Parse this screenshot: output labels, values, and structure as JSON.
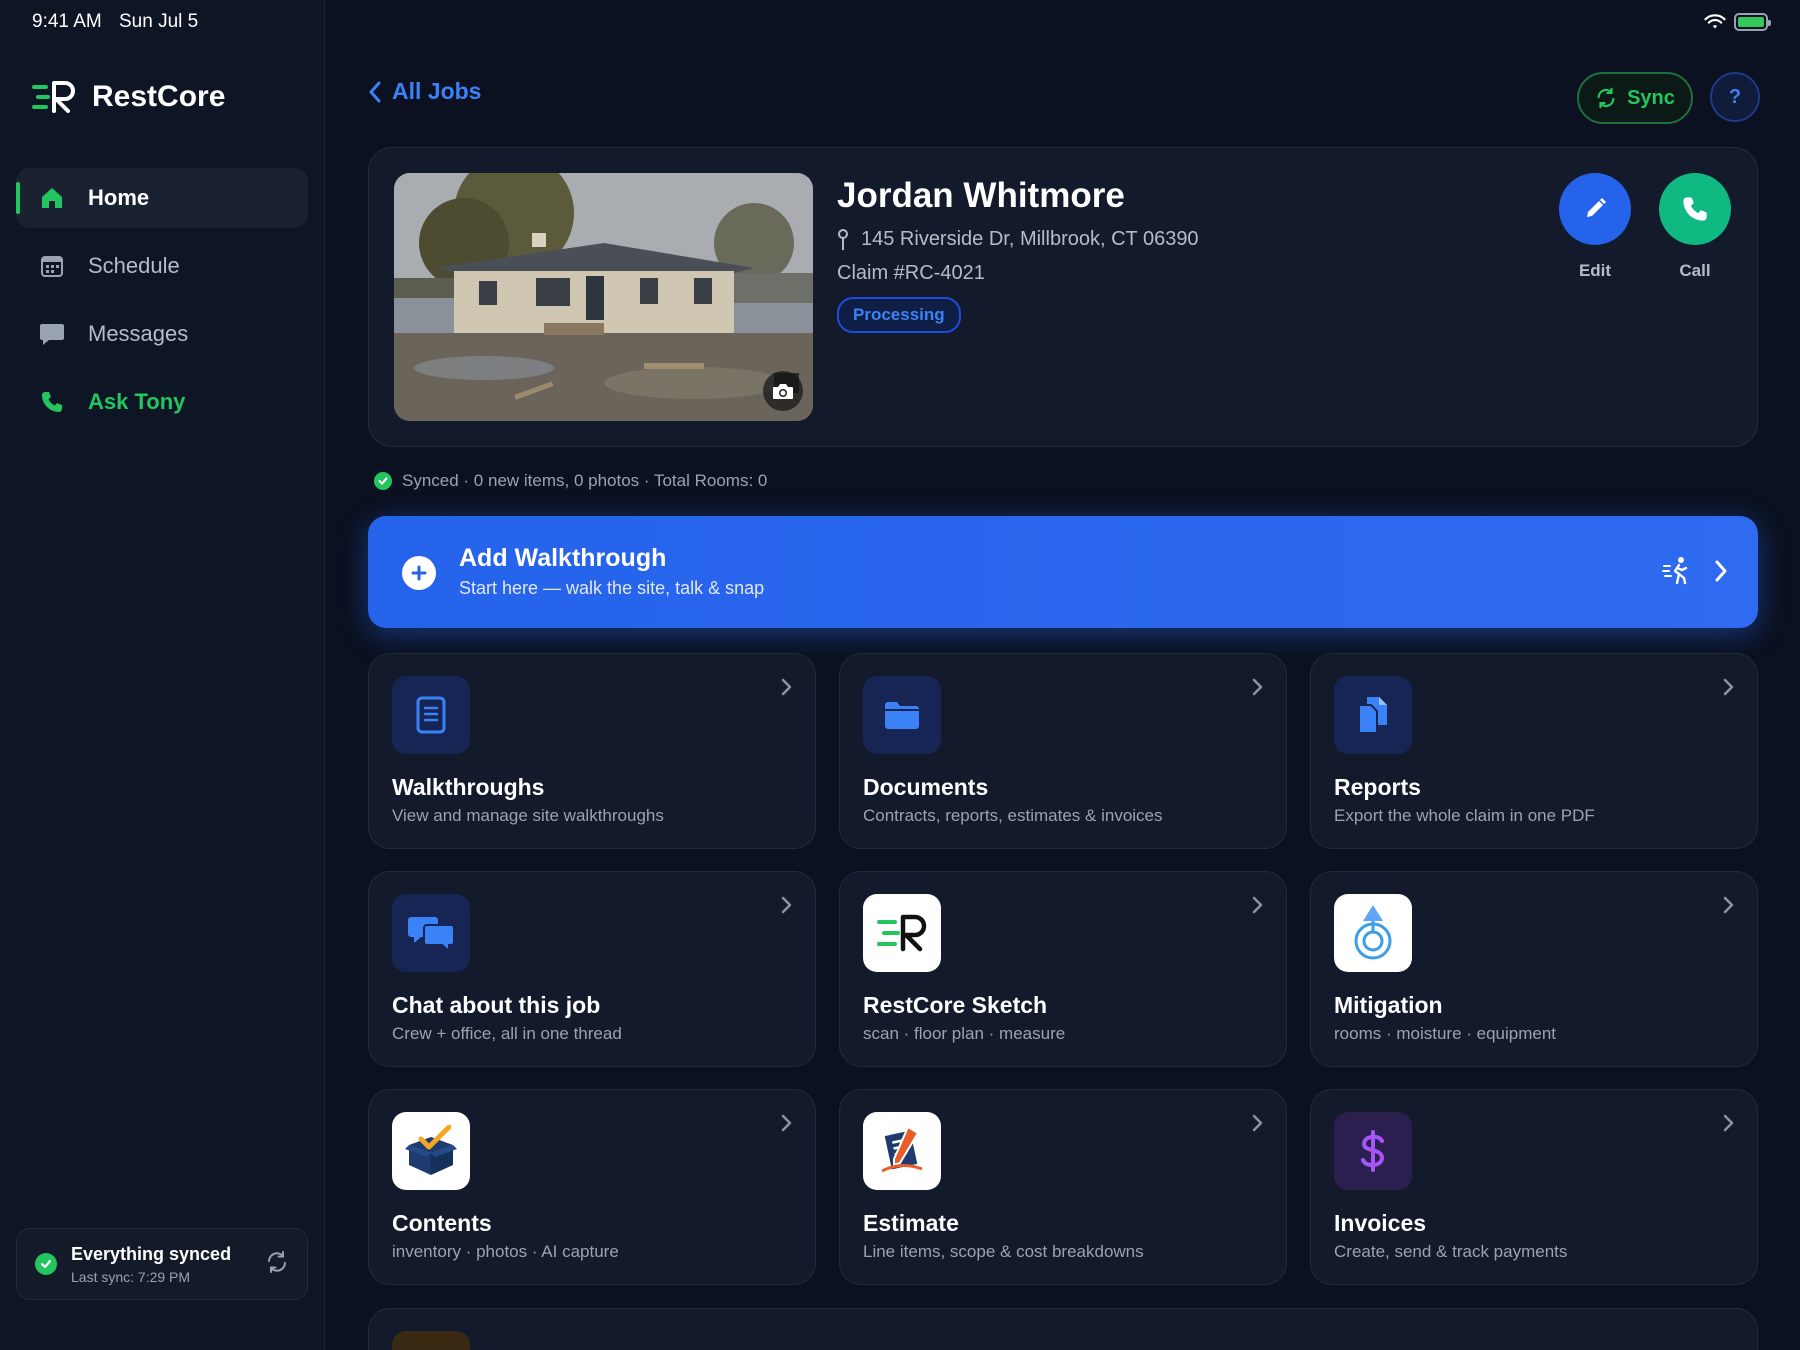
{
  "status_bar": {
    "time": "9:41 AM",
    "date": "Sun Jul 5"
  },
  "sidebar": {
    "brand": "RestCore",
    "items": [
      {
        "label": "Home",
        "icon": "home-icon",
        "active": true
      },
      {
        "label": "Schedule",
        "icon": "calendar-icon"
      },
      {
        "label": "Messages",
        "icon": "message-icon"
      },
      {
        "label": "Ask Tony",
        "icon": "phone-icon"
      }
    ],
    "sync": {
      "title": "Everything synced",
      "subtitle": "Last sync: 7:29 PM"
    }
  },
  "topbar": {
    "back_label": "All Jobs",
    "sync_label": "Sync",
    "help_label": "?"
  },
  "job": {
    "name": "Jordan Whitmore",
    "address": "145 Riverside Dr, Millbrook, CT 06390",
    "claim": "Claim #RC-4021",
    "status": "Processing",
    "actions": {
      "edit": "Edit",
      "call": "Call"
    }
  },
  "sync_status": "Synced · 0 new items, 0 photos · Total Rooms: 0",
  "walkthrough": {
    "title": "Add Walkthrough",
    "subtitle": "Start here — walk the site, talk & snap"
  },
  "tiles": [
    {
      "title": "Walkthroughs",
      "subtitle": "View and manage site walkthroughs",
      "icon": "document-list-icon"
    },
    {
      "title": "Documents",
      "subtitle": "Contracts, reports, estimates & invoices",
      "icon": "folder-icon"
    },
    {
      "title": "Reports",
      "subtitle": "Export the whole claim in one PDF",
      "icon": "copy-document-icon"
    },
    {
      "title": "Chat about this job",
      "subtitle": "Crew + office, all in one thread",
      "icon": "chat-bubbles-icon"
    },
    {
      "title": "RestCore Sketch",
      "subtitle": "scan · floor plan · measure",
      "icon": "restcore-logo-icon"
    },
    {
      "title": "Mitigation",
      "subtitle": "rooms · moisture · equipment",
      "icon": "water-drop-icon"
    },
    {
      "title": "Contents",
      "subtitle": "inventory · photos · AI capture",
      "icon": "box-check-icon"
    },
    {
      "title": "Estimate",
      "subtitle": "Line items, scope & cost breakdowns",
      "icon": "estimate-pen-icon"
    },
    {
      "title": "Invoices",
      "subtitle": "Create, send & track payments",
      "icon": "dollar-icon"
    }
  ],
  "colors": {
    "accent_blue": "#2563eb",
    "accent_green": "#22c55e",
    "background": "#0b1120",
    "card": "#121a2b"
  }
}
